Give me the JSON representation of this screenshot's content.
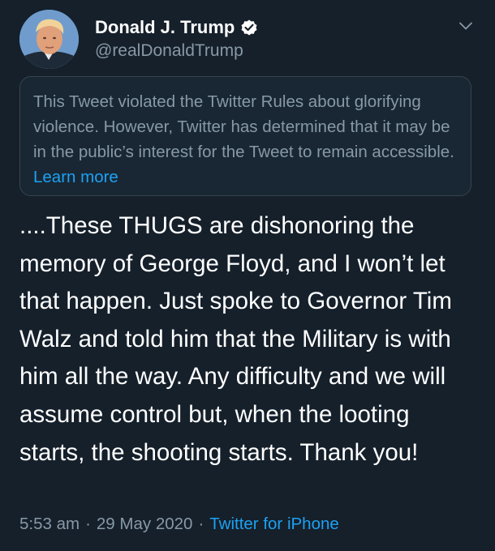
{
  "user": {
    "display_name": "Donald J. Trump",
    "handle": "@realDonaldTrump",
    "verified_icon": "verified-badge-icon",
    "avatar_icon": "profile-photo"
  },
  "menu": {
    "icon": "chevron-down-icon"
  },
  "notice": {
    "text": "This Tweet violated the Twitter Rules about glorifying violence. However, Twitter has determined that it may be in the public’s interest for the Tweet to remain accessible. ",
    "link_label": "Learn more"
  },
  "tweet": {
    "text": "....These THUGS are dishonoring the memory of George Floyd, and I won’t let that happen. Just spoke to Governor Tim Walz and told him that the Military is with him all the way. Any difficulty and we will assume control but, when the looting starts, the shooting starts. Thank you!"
  },
  "meta": {
    "time": "5:53 am",
    "date": "29 May 2020",
    "separator": "·",
    "source": "Twitter for iPhone"
  },
  "colors": {
    "background": "#15202b",
    "secondary_text": "#8899a6",
    "link": "#1da1f2",
    "notice_border": "#38444d"
  }
}
